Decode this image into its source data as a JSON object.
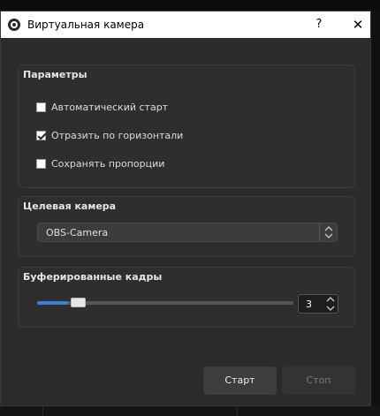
{
  "window": {
    "title": "Виртуальная камера",
    "help_label": "?",
    "close_label": "✕"
  },
  "params": {
    "title": "Параметры",
    "options": [
      {
        "label": "Автоматический старт",
        "checked": false
      },
      {
        "label": "Отразить по горизонтали",
        "checked": true
      },
      {
        "label": "Сохранять пропорции",
        "checked": false
      }
    ]
  },
  "target": {
    "title": "Целевая камера",
    "selected": "OBS-Camera"
  },
  "buffer": {
    "title": "Буферированные кадры",
    "value": "3",
    "slider_fraction": 0.12
  },
  "actions": {
    "start_label": "Старт",
    "stop_label": "Стоп"
  },
  "colors": {
    "accent": "#3d7fd6",
    "window_bg": "#2b2b2b",
    "titlebar_bg": "#ffffff"
  }
}
